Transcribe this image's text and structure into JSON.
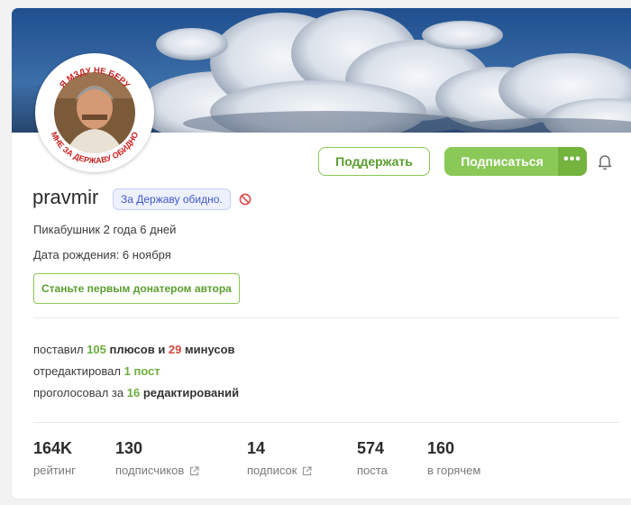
{
  "profile": {
    "username": "pravmir",
    "badge": "За Державу обидно.",
    "tenure": "Пикабушник 2 года 6 дней",
    "birthday": "Дата рождения: 6 ноября",
    "donate_label": "Станьте первым донатером автора",
    "avatar_text_top": "Я МЗДУ НЕ БЕРУ",
    "avatar_text_bottom": "МНЕ ЗА ДЕРЖАВУ ОБИДНО"
  },
  "actions": {
    "support_label": "Поддержать",
    "subscribe_label": "Подписаться",
    "more_label": "•••"
  },
  "activity": {
    "line1": {
      "prefix": "поставил ",
      "plus_count": "105",
      "plus_word": " плюсов и ",
      "minus_count": "29",
      "minus_word": " минусов"
    },
    "line2": {
      "prefix": "отредактировал ",
      "count": "1",
      "suffix": " пост"
    },
    "line3": {
      "prefix": "проголосовал за ",
      "count": "16",
      "suffix": " редактирований"
    }
  },
  "metrics": [
    {
      "value": "164K",
      "label": "рейтинг"
    },
    {
      "value": "130",
      "label": "подписчиков"
    },
    {
      "value": "14",
      "label": "подписок"
    },
    {
      "value": "574",
      "label": "поста"
    },
    {
      "value": "160",
      "label": "в горячем"
    }
  ],
  "colors": {
    "accent_green": "#8ac858",
    "plus_green": "#6bae3c",
    "minus_red": "#d0483b",
    "badge_blue": "#4157c9",
    "cover_sky": "#2f5fa0"
  },
  "icons": {
    "bell": "bell-icon",
    "ban": "ban-icon",
    "external": "external-link-icon"
  }
}
